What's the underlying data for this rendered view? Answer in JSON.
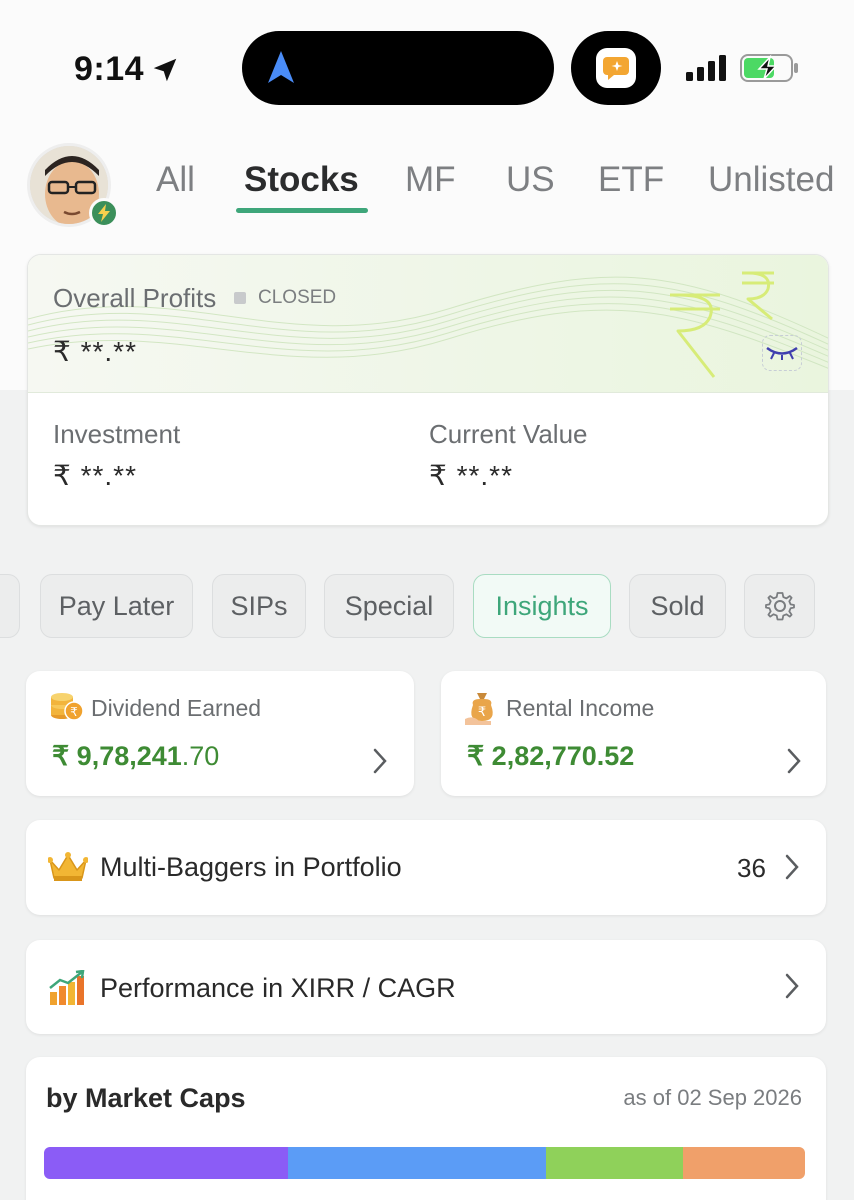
{
  "status_bar": {
    "time": "9:14"
  },
  "tabs": [
    {
      "label": "All"
    },
    {
      "label": "Stocks"
    },
    {
      "label": "MF"
    },
    {
      "label": "US"
    },
    {
      "label": "ETF"
    },
    {
      "label": "Unlisted"
    }
  ],
  "profit_card": {
    "title": "Overall Profits",
    "status": "CLOSED",
    "value": "₹ **.**",
    "investment_label": "Investment",
    "investment_value": "₹ **.**",
    "current_label": "Current Value",
    "current_value": "₹ **.**"
  },
  "chips": [
    {
      "label": "Pay Later"
    },
    {
      "label": "SIPs"
    },
    {
      "label": "Special"
    },
    {
      "label": "Insights"
    },
    {
      "label": "Sold"
    }
  ],
  "dividend": {
    "label": "Dividend Earned",
    "value_main": "₹ 9,78,241",
    "value_decimal": ".70"
  },
  "rental": {
    "label": "Rental Income",
    "value": "₹ 2,82,770.52"
  },
  "multibaggers": {
    "label": "Multi-Baggers in Portfolio",
    "count": "36"
  },
  "performance": {
    "label": "Performance in XIRR / CAGR"
  },
  "market_caps": {
    "title": "by Market Caps",
    "date": "as of 02 Sep 2026",
    "segments": [
      {
        "color": "#8b5cf6",
        "share": 0.32
      },
      {
        "color": "#5b9cf6",
        "share": 0.34
      },
      {
        "color": "#8fd15a",
        "share": 0.18
      },
      {
        "color": "#f0a06a",
        "share": 0.16
      }
    ]
  },
  "colors": {
    "accent": "#3ea67a",
    "positive": "#3e8b34"
  }
}
